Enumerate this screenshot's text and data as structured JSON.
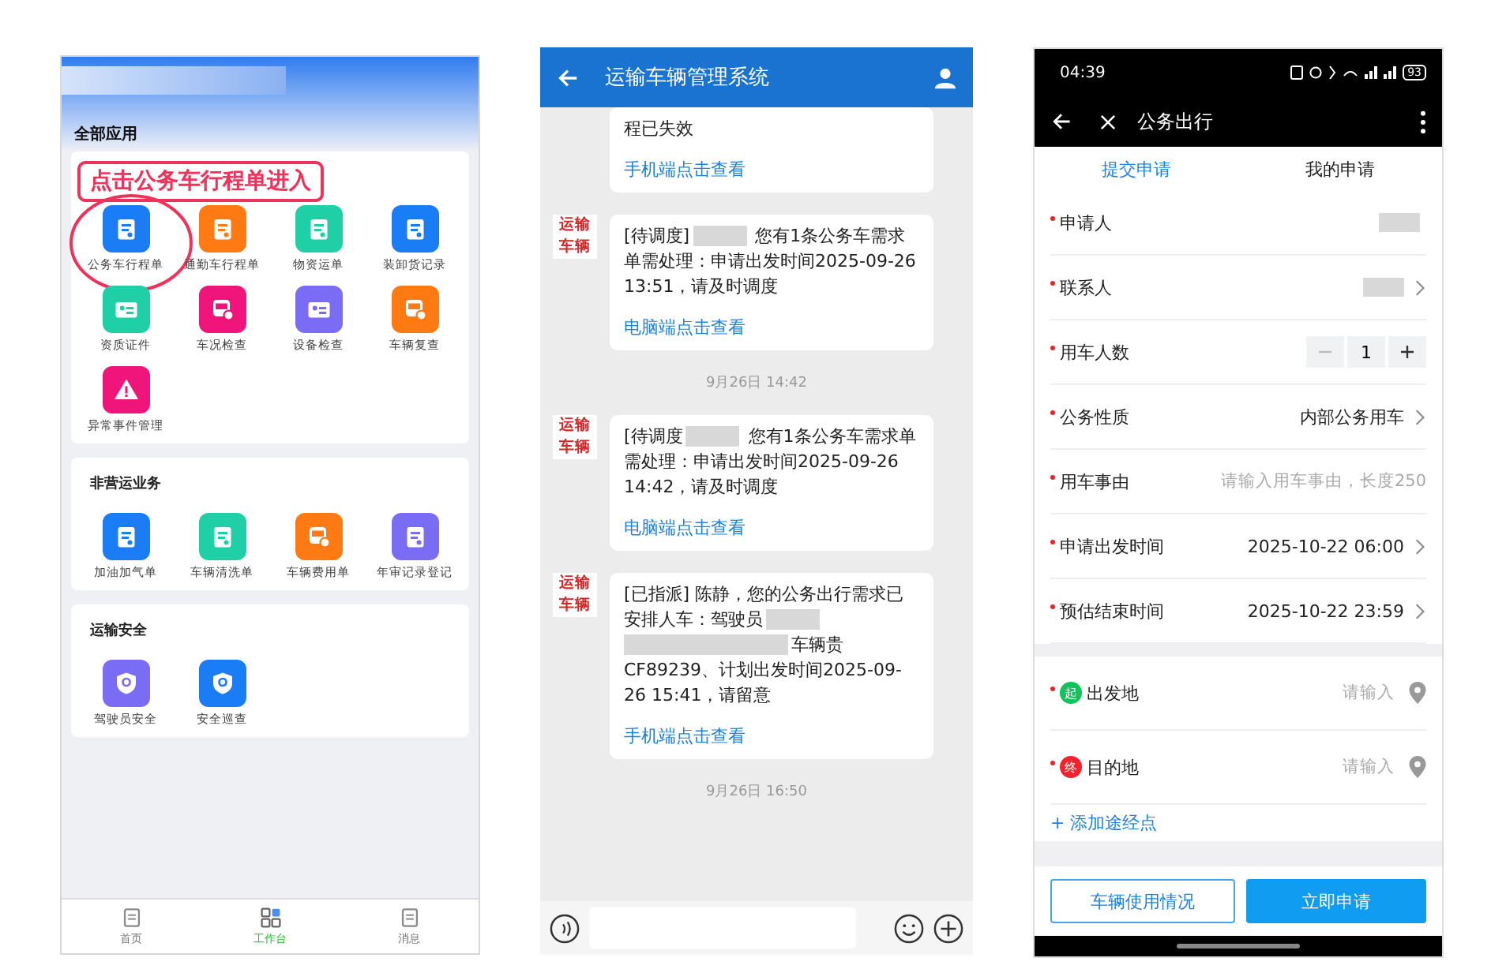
{
  "workbench": {
    "heading": "全部应用",
    "callout": "点击公务车行程单进入",
    "sections": [
      {
        "apps": [
          {
            "label": "公务车行程单",
            "color": "#1a7df5",
            "kind": "doc",
            "circled": true
          },
          {
            "label": "通勤车行程单",
            "color": "#ff7a12",
            "kind": "doc",
            "circled": false
          },
          {
            "label": "物资运单",
            "color": "#1fcfa6",
            "kind": "doc",
            "circled": false
          },
          {
            "label": "装卸货记录",
            "color": "#1a7df5",
            "kind": "doc",
            "circled": false
          },
          {
            "label": "资质证件",
            "color": "#1fcfa6",
            "kind": "card",
            "circled": false
          },
          {
            "label": "车况检查",
            "color": "#f0157a",
            "kind": "bus",
            "circled": false
          },
          {
            "label": "设备检查",
            "color": "#7b6cf5",
            "kind": "card",
            "circled": false
          },
          {
            "label": "车辆复查",
            "color": "#ff7a12",
            "kind": "bus",
            "circled": false
          },
          {
            "label": "异常事件管理",
            "color": "#f0157a",
            "kind": "warning",
            "circled": false
          }
        ]
      },
      {
        "title": "非营运业务",
        "apps": [
          {
            "label": "加油加气单",
            "color": "#1a7df5",
            "kind": "doc",
            "circled": false
          },
          {
            "label": "车辆清洗单",
            "color": "#1fcfa6",
            "kind": "doc",
            "circled": false
          },
          {
            "label": "车辆费用单",
            "color": "#ff7a12",
            "kind": "bus",
            "circled": false
          },
          {
            "label": "年审记录登记",
            "color": "#7b6cf5",
            "kind": "doc",
            "circled": false
          }
        ]
      },
      {
        "title": "运输安全",
        "apps": [
          {
            "label": "驾驶员安全",
            "color": "#7b6cf5",
            "kind": "shield",
            "circled": false
          },
          {
            "label": "安全巡查",
            "color": "#1a7df5",
            "kind": "shield",
            "circled": false
          }
        ]
      }
    ],
    "nav": [
      {
        "label": "首页",
        "selected": false
      },
      {
        "label": "工作台",
        "selected": true
      },
      {
        "label": "消息",
        "selected": false
      }
    ]
  },
  "chat": {
    "title": "运输车辆管理系统",
    "items": [
      {
        "kind": "message",
        "segments": [
          {
            "kind": "text",
            "text": "程已失效"
          }
        ],
        "link": "手机端点击查看"
      },
      {
        "kind": "message",
        "avatar": "运输车辆",
        "segments": [
          {
            "kind": "text",
            "text": "[待调度]"
          },
          {
            "kind": "redacted"
          },
          {
            "kind": "text",
            "text": " 您有1条公务车需求单需处理：申请出发时间2025-09-26 13:51，请及时调度"
          }
        ],
        "link": "电脑端点击查看"
      },
      {
        "kind": "time",
        "text": "9月26日  14:42"
      },
      {
        "kind": "message",
        "avatar": "运输车辆",
        "segments": [
          {
            "kind": "text",
            "text": "[待调度"
          },
          {
            "kind": "redacted"
          },
          {
            "kind": "text",
            "text": " 您有1条公务车需求单需处理：申请出发时间2025-09-26 14:42，请及时调度"
          }
        ],
        "link": "电脑端点击查看"
      },
      {
        "kind": "message",
        "avatar": "运输车辆",
        "segments": [
          {
            "kind": "text",
            "text": "[已指派] 陈静，您的公务出行需求已安排人车：驾驶员"
          },
          {
            "kind": "redacted"
          },
          {
            "kind": "redacted-wide"
          },
          {
            "kind": "text",
            "text": "车辆贵CF89239、计划出发时间2025-09-26 15:41，请留意"
          }
        ],
        "link": "手机端点击查看"
      },
      {
        "kind": "time",
        "text": "9月26日  16:50"
      }
    ]
  },
  "form": {
    "status": {
      "time": "04:39",
      "battery": "93"
    },
    "title": "公务出行",
    "tabs": [
      {
        "label": "提交申请",
        "selected": true
      },
      {
        "label": "我的申请",
        "selected": false
      }
    ],
    "groups": [
      [
        {
          "kind": "redacted",
          "label": "申请人",
          "required": true
        },
        {
          "kind": "redacted-select",
          "label": "联系人",
          "required": true
        },
        {
          "kind": "stepper",
          "label": "用车人数",
          "required": true,
          "value": "1"
        },
        {
          "kind": "select",
          "label": "公务性质",
          "required": true,
          "value": "内部公务用车"
        },
        {
          "kind": "input",
          "label": "用车事由",
          "required": true,
          "placeholder": "请输入用车事由，长度250"
        },
        {
          "kind": "select",
          "label": "申请出发时间",
          "required": true,
          "value": "2025-10-22 06:00"
        },
        {
          "kind": "select",
          "label": "预估结束时间",
          "required": true,
          "value": "2025-10-22 23:59"
        }
      ],
      [
        {
          "kind": "location",
          "label": "出发地",
          "required": true,
          "badge": "起",
          "color": "#12c25a",
          "placeholder": "请输入"
        },
        {
          "kind": "location",
          "label": "目的地",
          "required": true,
          "badge": "终",
          "color": "#f5222d",
          "placeholder": "请输入"
        }
      ]
    ],
    "add_stop": "+ 添加途经点",
    "buttons": [
      {
        "label": "车辆使用情况",
        "kind": "secondary"
      },
      {
        "label": "立即申请",
        "kind": "primary"
      }
    ]
  }
}
